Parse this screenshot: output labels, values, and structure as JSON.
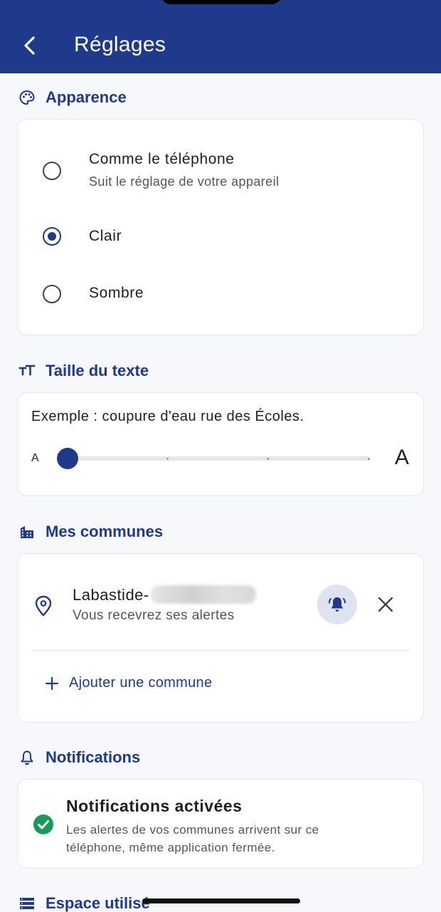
{
  "header": {
    "title": "Réglages",
    "back_icon": "chevron-left-icon"
  },
  "appearance": {
    "title": "Apparence",
    "icon": "palette-icon",
    "options": [
      {
        "label": "Comme le téléphone",
        "subtitle": "Suit le réglage de votre appareil",
        "selected": false
      },
      {
        "label": "Clair",
        "selected": true
      },
      {
        "label": "Sombre",
        "selected": false
      }
    ]
  },
  "text_size": {
    "title": "Taille du texte",
    "icon": "text-size-icon",
    "sample": "Exemple : coupure d'eau rue des Écoles.",
    "small_label": "A",
    "large_label": "A",
    "level": 0,
    "steps": 4
  },
  "communes": {
    "title": "Mes communes",
    "icon": "buildings-icon",
    "items": [
      {
        "name": "Labastide-",
        "subtitle": "Vous recevrez ses alertes",
        "alerts_enabled": true
      }
    ],
    "add_label": "Ajouter une commune"
  },
  "notifications": {
    "title": "Notifications",
    "icon": "bell-outline-icon",
    "status_title": "Notifications activées",
    "status_desc": "Les alertes de vos communes arrivent sur ce téléphone, même application fermée."
  },
  "storage": {
    "title": "Espace utilisé",
    "icon": "list-icon"
  },
  "colors": {
    "primary": "#1f3a8a",
    "success": "#1a9a5a",
    "background": "#f6f8fc"
  }
}
